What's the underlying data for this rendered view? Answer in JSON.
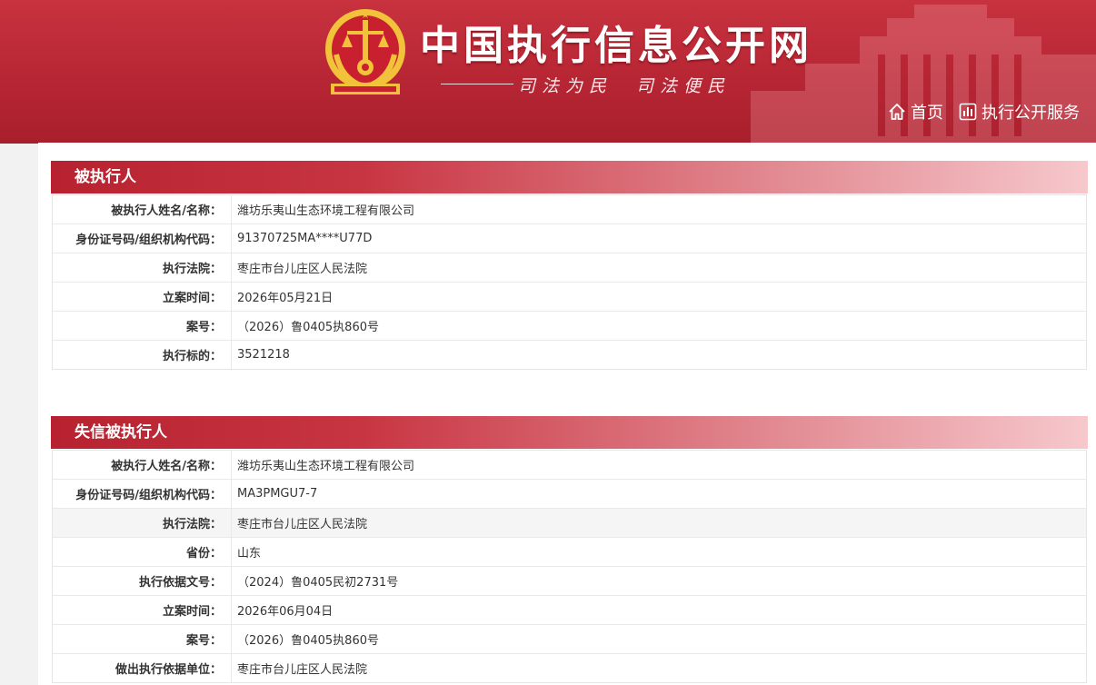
{
  "header": {
    "site_title": "中国执行信息公开网",
    "slogan": "司法为民　司法便民",
    "nav": [
      {
        "label": "首页",
        "icon": "home-icon"
      },
      {
        "label": "执行公开服务",
        "icon": "bar-chart-icon"
      }
    ]
  },
  "sections": [
    {
      "title": "被执行人",
      "rows": [
        {
          "label": "被执行人姓名/名称：",
          "value": "潍坊乐夷山生态环境工程有限公司"
        },
        {
          "label": "身份证号码/组织机构代码：",
          "value": "91370725MA****U77D"
        },
        {
          "label": "执行法院：",
          "value": "枣庄市台儿庄区人民法院"
        },
        {
          "label": "立案时间：",
          "value": "2026年05月21日"
        },
        {
          "label": "案号：",
          "value": "（2026）鲁0405执860号"
        },
        {
          "label": "执行标的：",
          "value": "3521218"
        }
      ]
    },
    {
      "title": "失信被执行人",
      "rows": [
        {
          "label": "被执行人姓名/名称：",
          "value": "潍坊乐夷山生态环境工程有限公司"
        },
        {
          "label": "身份证号码/组织机构代码：",
          "value": "MA3PMGU7-7"
        },
        {
          "label": "执行法院：",
          "value": "枣庄市台儿庄区人民法院"
        },
        {
          "label": "省份：",
          "value": "山东"
        },
        {
          "label": "执行依据文号：",
          "value": "（2024）鲁0405民初2731号"
        },
        {
          "label": "立案时间：",
          "value": "2026年06月04日"
        },
        {
          "label": "案号：",
          "value": "（2026）鲁0405执860号"
        },
        {
          "label": "做出执行依据单位：",
          "value": "枣庄市台儿庄区人民法院"
        }
      ]
    }
  ],
  "colors": {
    "header_red": "#b62533",
    "section_head_start": "#b72230",
    "section_head_end": "#f6c8cc",
    "emblem_gold": "#f2c23a"
  }
}
